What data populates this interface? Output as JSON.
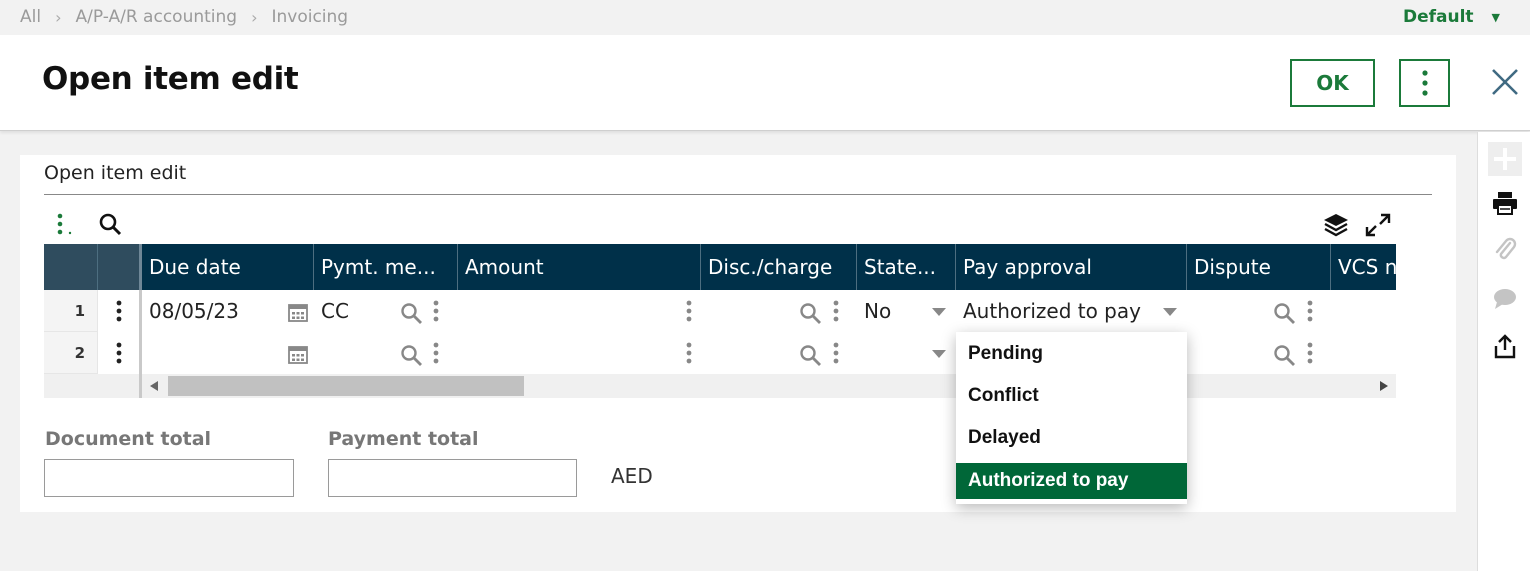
{
  "breadcrumb": {
    "items": [
      "All",
      "A/P-A/R accounting",
      "Invoicing"
    ]
  },
  "view_selector": {
    "label": "Default"
  },
  "header": {
    "title": "Open item edit",
    "ok_label": "OK"
  },
  "panel": {
    "title": "Open item edit"
  },
  "grid": {
    "columns": [
      "Due date",
      "Pymt. me...",
      "Amount",
      "Disc./charge",
      "State...",
      "Pay approval",
      "Dispute",
      "VCS n"
    ],
    "rows": [
      {
        "num": "1",
        "due_date": "08/05/23",
        "pymt_method": "CC",
        "amount": "",
        "disc_charge": "",
        "state": "No",
        "pay_approval": "Authorized to pay",
        "dispute": ""
      },
      {
        "num": "2",
        "due_date": "",
        "pymt_method": "",
        "amount": "",
        "disc_charge": "",
        "state": "",
        "pay_approval": "",
        "dispute": ""
      }
    ]
  },
  "totals": {
    "document_total_label": "Document total",
    "document_total_value": "",
    "payment_total_label": "Payment total",
    "payment_total_value": "",
    "currency": "AED"
  },
  "pay_approval_dropdown": {
    "options": [
      "Pending",
      "Conflict",
      "Delayed",
      "Authorized to pay"
    ],
    "selected": "Authorized to pay"
  },
  "colors": {
    "brand_green": "#1b7a3a",
    "selected_option": "#006738",
    "grid_header": "#003049"
  },
  "icons": [
    "chevron-right-icon",
    "caret-down-icon",
    "more-vertical-icon",
    "close-icon",
    "plus-icon",
    "print-icon",
    "attachment-icon",
    "comment-icon",
    "share-icon",
    "search-icon",
    "layers-icon",
    "expand-icon",
    "calendar-icon"
  ]
}
